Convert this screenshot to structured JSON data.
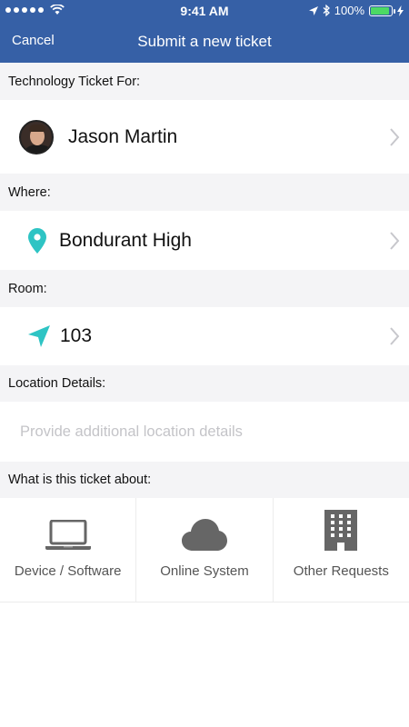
{
  "status_bar": {
    "time": "9:41 AM",
    "battery": "100%"
  },
  "nav": {
    "cancel": "Cancel",
    "title": "Submit a new ticket"
  },
  "sections": {
    "ticket_for": {
      "label": "Technology Ticket For:",
      "value": "Jason Martin"
    },
    "where": {
      "label": "Where:",
      "value": "Bondurant High"
    },
    "room": {
      "label": "Room:",
      "value": "103"
    },
    "location_details": {
      "label": "Location Details:",
      "placeholder": "Provide additional location details"
    },
    "about": {
      "label": "What is this ticket about:"
    }
  },
  "categories": [
    {
      "label": "Device / Software",
      "icon": "laptop-icon"
    },
    {
      "label": "Online System",
      "icon": "cloud-icon"
    },
    {
      "label": "Other Requests",
      "icon": "building-icon"
    }
  ],
  "colors": {
    "header": "#3660a6",
    "accent": "#2ec4c4",
    "icon_gray": "#666666",
    "section_bg": "#f4f4f6"
  }
}
